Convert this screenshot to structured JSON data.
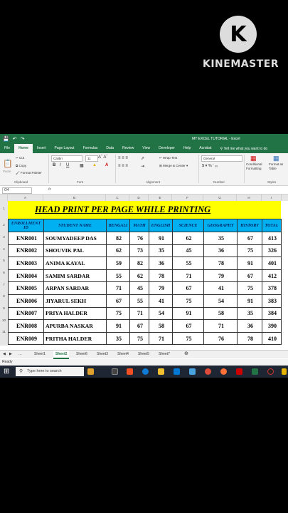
{
  "watermark": {
    "logo_letter": "K",
    "text": "KINEMASTER"
  },
  "window": {
    "title": "MY EXCEL TUTORIAL - Excel"
  },
  "menu": [
    "File",
    "Home",
    "Insert",
    "Page Layout",
    "Formulas",
    "Data",
    "Review",
    "View",
    "Developer",
    "Help",
    "Acrobat"
  ],
  "tell_me": "Tell me what you want to do",
  "ribbon": {
    "paste": "Paste",
    "cut": "Cut",
    "copy": "Copy",
    "format_painter": "Format Painter",
    "font_name": "Calibri",
    "font_size": "11",
    "wrap_text": "Wrap Text",
    "merge_center": "Merge & Center",
    "number_format": "General",
    "conditional_formatting": "Conditional Formatting",
    "format_as_table": "Format as Table",
    "groups": {
      "clipboard": "Clipboard",
      "font": "Font",
      "alignment": "Alignment",
      "number": "Number",
      "styles": "Styles"
    }
  },
  "name_box": "O4",
  "fx": "fx",
  "columns": [
    "A",
    "B",
    "C",
    "D",
    "E",
    "F",
    "G",
    "H",
    "I"
  ],
  "sheet_title": "HEAD PRINT PER PAGE WHILE PRINTING",
  "table": {
    "headers": [
      "ENROLLMENT ID",
      "STUDENT NAME",
      "BENGALI",
      "MATH",
      "ENGLISH",
      "SCIENCE",
      "GEOGRAPHY",
      "HISTORY",
      "TOTAL"
    ],
    "rows": [
      [
        "ENR001",
        "SOUMYADEEP DAS",
        "82",
        "76",
        "91",
        "62",
        "35",
        "67",
        "413"
      ],
      [
        "ENR002",
        "SHOUVIK PAL",
        "62",
        "73",
        "35",
        "45",
        "36",
        "75",
        "326"
      ],
      [
        "ENR003",
        "ANIMA KAYAL",
        "59",
        "82",
        "36",
        "55",
        "78",
        "91",
        "401"
      ],
      [
        "ENR004",
        "SAMIM SARDAR",
        "55",
        "62",
        "78",
        "71",
        "79",
        "67",
        "412"
      ],
      [
        "ENR005",
        "ARPAN SARDAR",
        "71",
        "45",
        "79",
        "67",
        "41",
        "75",
        "378"
      ],
      [
        "ENR006",
        "JIYARUL SEKH",
        "67",
        "55",
        "41",
        "75",
        "54",
        "91",
        "383"
      ],
      [
        "ENR007",
        "PRIYA HALDER",
        "75",
        "71",
        "54",
        "91",
        "58",
        "35",
        "384"
      ],
      [
        "ENR008",
        "APURBA NASKAR",
        "91",
        "67",
        "58",
        "67",
        "71",
        "36",
        "390"
      ],
      [
        "ENR009",
        "PRITHA HALDER",
        "35",
        "75",
        "71",
        "75",
        "76",
        "78",
        "410"
      ]
    ]
  },
  "sheets": [
    "Sheet1",
    "Sheet2",
    "Sheet6",
    "Sheet3",
    "Sheet4",
    "Sheet5",
    "Sheet7"
  ],
  "active_sheet": "Sheet2",
  "status": "Ready",
  "taskbar": {
    "search_placeholder": "Type here to search"
  }
}
